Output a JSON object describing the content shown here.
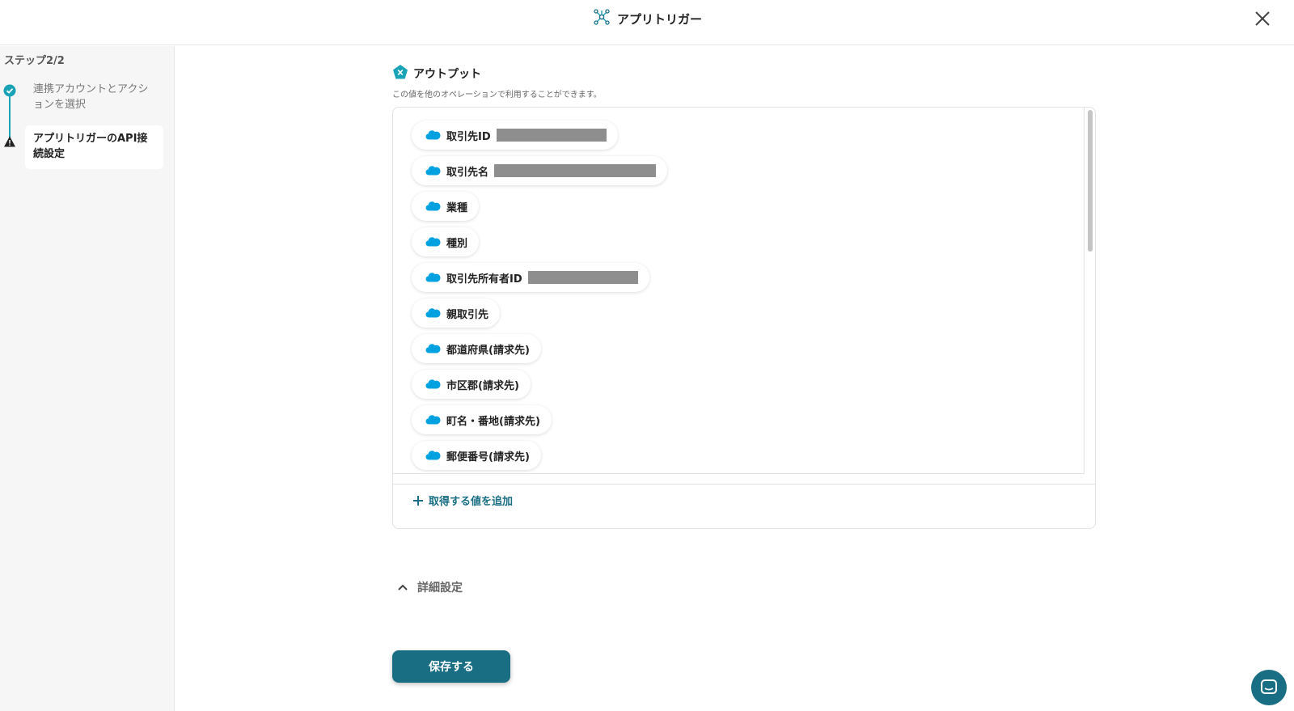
{
  "header": {
    "title": "アプリトリガー"
  },
  "sidebar": {
    "step_label": "ステップ2/2",
    "steps": [
      {
        "label": "連携アカウントとアクションを選択",
        "status": "done"
      },
      {
        "label": "アプリトリガーのAPI接続設定",
        "status": "warning"
      }
    ]
  },
  "output": {
    "title": "アウトプット",
    "description": "この値を他のオペレーションで利用することができます。",
    "items": [
      {
        "label": "取引先ID",
        "redacted": true
      },
      {
        "label": "取引先名",
        "redacted": true
      },
      {
        "label": "業種",
        "redacted": false
      },
      {
        "label": "種別",
        "redacted": false
      },
      {
        "label": "取引先所有者ID",
        "redacted": true
      },
      {
        "label": "親取引先",
        "redacted": false
      },
      {
        "label": "都道府県(請求先)",
        "redacted": false
      },
      {
        "label": "市区郡(請求先)",
        "redacted": false
      },
      {
        "label": "町名・番地(請求先)",
        "redacted": false
      },
      {
        "label": "郵便番号(請求先)",
        "redacted": false
      }
    ],
    "add_label": "取得する値を追加"
  },
  "details": {
    "label": "詳細設定"
  },
  "save_label": "保存する",
  "colors": {
    "accent": "#1a6e84",
    "teal": "#1aa3b6",
    "salesforce_blue": "#00a1e0",
    "redaction_gray": "#8e8e8e"
  }
}
